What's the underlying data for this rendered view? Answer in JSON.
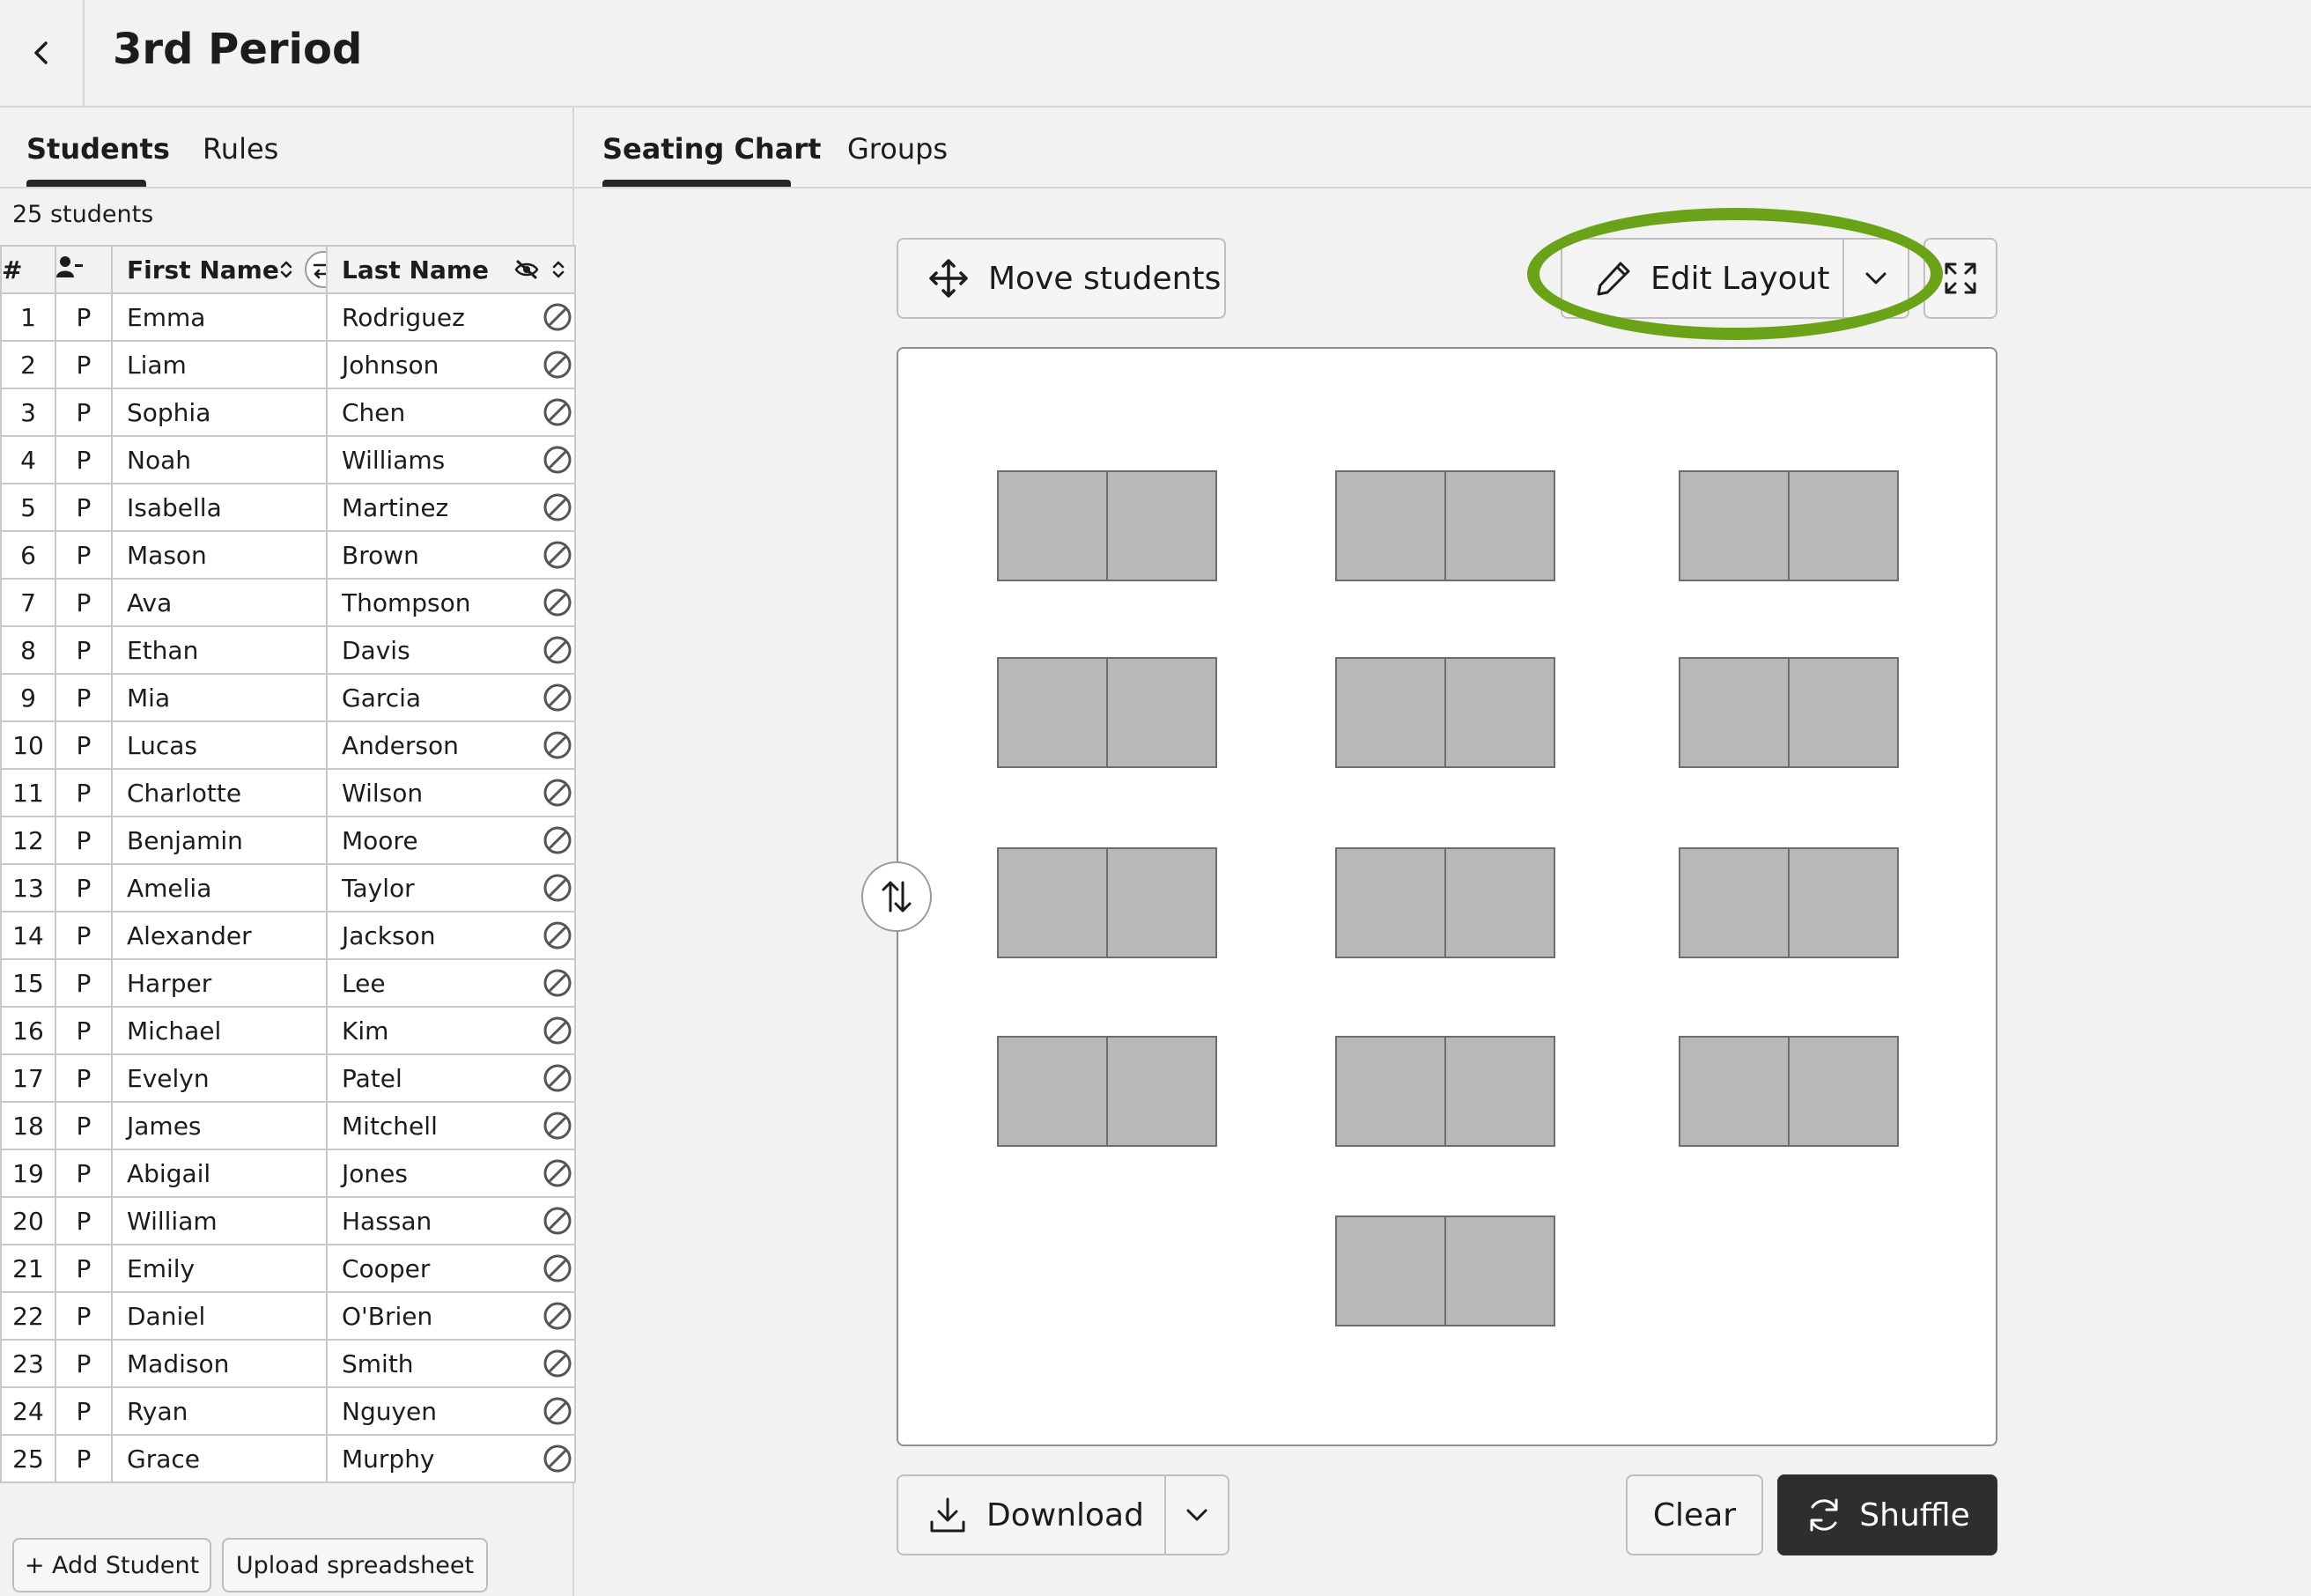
{
  "header": {
    "title": "3rd Period"
  },
  "left_tabs": [
    {
      "label": "Students",
      "active": true
    },
    {
      "label": "Rules",
      "active": false
    }
  ],
  "student_count": "25 students",
  "table": {
    "headers": {
      "num": "#",
      "first": "First Name",
      "last": "Last Name"
    },
    "rows": [
      [
        "1",
        "P",
        "Emma",
        "Rodriguez"
      ],
      [
        "2",
        "P",
        "Liam",
        "Johnson"
      ],
      [
        "3",
        "P",
        "Sophia",
        "Chen"
      ],
      [
        "4",
        "P",
        "Noah",
        "Williams"
      ],
      [
        "5",
        "P",
        "Isabella",
        "Martinez"
      ],
      [
        "6",
        "P",
        "Mason",
        "Brown"
      ],
      [
        "7",
        "P",
        "Ava",
        "Thompson"
      ],
      [
        "8",
        "P",
        "Ethan",
        "Davis"
      ],
      [
        "9",
        "P",
        "Mia",
        "Garcia"
      ],
      [
        "10",
        "P",
        "Lucas",
        "Anderson"
      ],
      [
        "11",
        "P",
        "Charlotte",
        "Wilson"
      ],
      [
        "12",
        "P",
        "Benjamin",
        "Moore"
      ],
      [
        "13",
        "P",
        "Amelia",
        "Taylor"
      ],
      [
        "14",
        "P",
        "Alexander",
        "Jackson"
      ],
      [
        "15",
        "P",
        "Harper",
        "Lee"
      ],
      [
        "16",
        "P",
        "Michael",
        "Kim"
      ],
      [
        "17",
        "P",
        "Evelyn",
        "Patel"
      ],
      [
        "18",
        "P",
        "James",
        "Mitchell"
      ],
      [
        "19",
        "P",
        "Abigail",
        "Jones"
      ],
      [
        "20",
        "P",
        "William",
        "Hassan"
      ],
      [
        "21",
        "P",
        "Emily",
        "Cooper"
      ],
      [
        "22",
        "P",
        "Daniel",
        "O'Brien"
      ],
      [
        "23",
        "P",
        "Madison",
        "Smith"
      ],
      [
        "24",
        "P",
        "Ryan",
        "Nguyen"
      ],
      [
        "25",
        "P",
        "Grace",
        "Murphy"
      ]
    ]
  },
  "left_buttons": {
    "add": "+ Add Student",
    "upload": "Upload spreadsheet"
  },
  "right_tabs": [
    {
      "label": "Seating Chart",
      "active": true
    },
    {
      "label": "Groups",
      "active": false
    }
  ],
  "toolbar": {
    "move": "Move students",
    "edit_layout": "Edit Layout"
  },
  "bottom": {
    "download": "Download",
    "clear": "Clear",
    "shuffle": "Shuffle"
  },
  "seating": {
    "desk_count": 13,
    "seats_per_desk": 2
  },
  "colors": {
    "highlight": "#6aa318",
    "shuffle_bg": "#2e2e2e",
    "seat": "#b8b8b8"
  },
  "icons": {
    "back": "chevron-left-icon",
    "move": "move-arrows-icon",
    "edit": "pencil-icon",
    "fullscreen": "expand-icon",
    "download": "download-icon",
    "shuffle": "refresh-icon",
    "swap": "swap-vertical-icon",
    "ban": "ban-icon"
  }
}
